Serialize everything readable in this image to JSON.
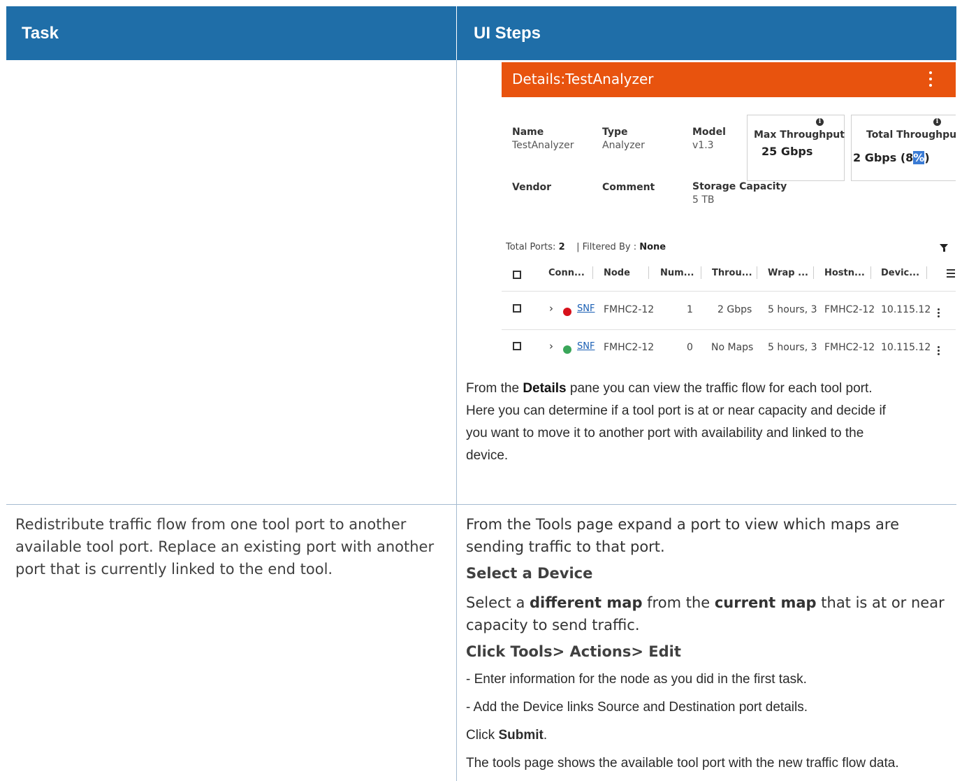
{
  "header": {
    "task": "Task",
    "steps": "UI Steps"
  },
  "screenshot": {
    "title": "Details:TestAnalyzer",
    "fields": {
      "name_label": "Name",
      "name_value": "TestAnalyzer",
      "type_label": "Type",
      "type_value": "Analyzer",
      "model_label": "Model",
      "model_value": "v1.3",
      "vendor_label": "Vendor",
      "comment_label": "Comment",
      "storage_label": "Storage Capacity",
      "storage_value": "5 TB"
    },
    "max_throughput": {
      "label": "Max Throughput",
      "value": "25 Gbps"
    },
    "total_throughput": {
      "label": "Total Throughput",
      "value_prefix": "2 Gbps (8",
      "value_highlight": "%",
      "value_suffix": ")"
    },
    "ports": {
      "total_label": "Total Ports:",
      "total_value": "2",
      "filter_label": "| Filtered By :",
      "filter_value": "None"
    },
    "columns": [
      "Conn...",
      "Node",
      "Num...",
      "Throu...",
      "Wrap ...",
      "Hostn...",
      "Devic..."
    ],
    "rows": [
      {
        "status": "red",
        "conn": "SNF",
        "node": "FMHC2-12",
        "num": "1",
        "throughput": "2 Gbps",
        "wrap": "5 hours, 3",
        "hostname": "FMHC2-12",
        "device": "10.115.12"
      },
      {
        "status": "green",
        "conn": "SNF",
        "node": "FMHC2-12",
        "num": "0",
        "throughput": "No Maps",
        "wrap": "5 hours, 3",
        "hostname": "FMHC2-12",
        "device": "10.115.12"
      }
    ]
  },
  "row1": {
    "desc_pre": "From the ",
    "desc_bold": "Details",
    "desc_post": " pane you can view the traffic flow for each tool port.",
    "desc_line2": "Here you can determine if a tool port is at or near capacity and decide if",
    "desc_line3": "you want to move it to another port with availability and linked to the",
    "desc_line4": "device."
  },
  "row2": {
    "task": "Redistribute traffic flow from one tool port to another available tool port. Replace an existing port with another port that is currently linked to the end tool.",
    "step1": "From the Tools page expand a port to view which maps are sending traffic to that port.",
    "heading1": "Select a Device",
    "step2_a": "Select a ",
    "step2_b": "different map",
    "step2_c": " from the ",
    "step2_d": "current map",
    "step2_e": " that is at or near capacity to send traffic.",
    "heading2": "Click Tools> Actions> Edit",
    "bullet1": "- Enter information for the node as you did in the first task.",
    "bullet2": "- Add the Device links Source and Destination port details.",
    "click_a": "Click ",
    "click_b": "Submit",
    "click_c": ".",
    "final": "The tools page shows the available tool port with the new traffic flow data."
  }
}
